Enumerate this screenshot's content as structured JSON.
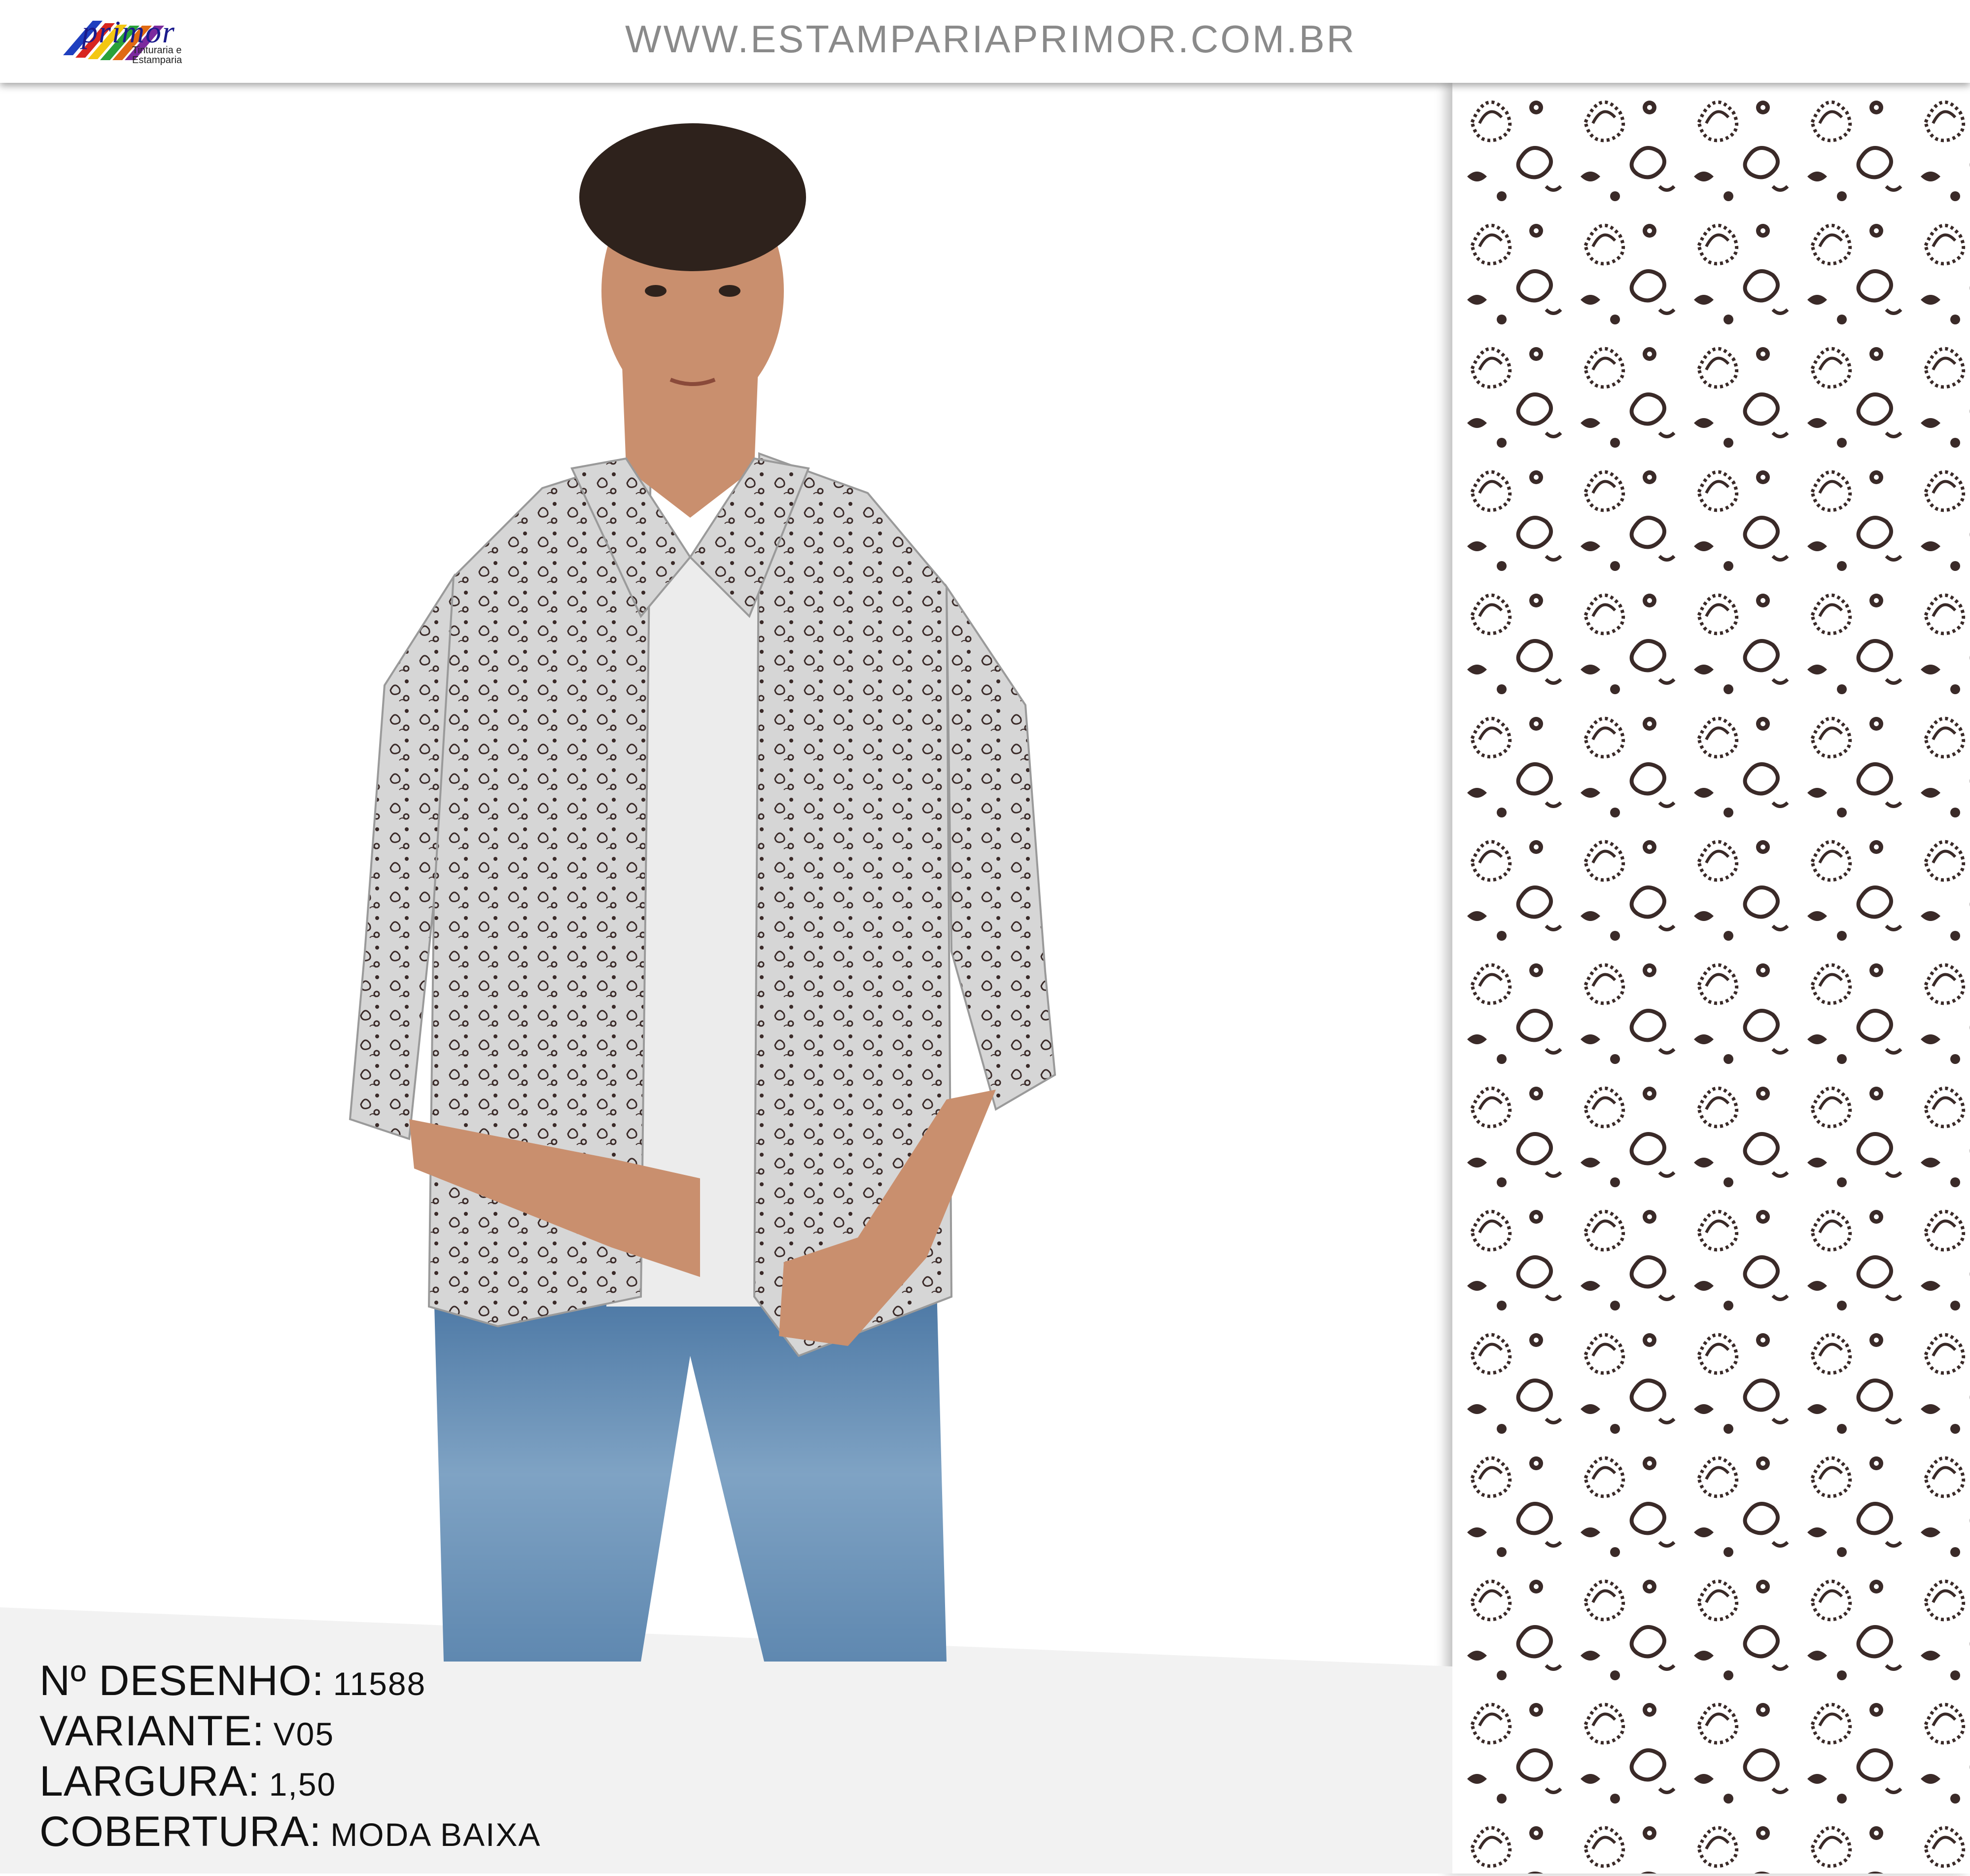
{
  "header": {
    "logo_text": "primor",
    "logo_tagline": "Tinturaria e Estamparia",
    "site_url": "WWW.ESTAMPARIAPRIMOR.COM.BR"
  },
  "product": {
    "image_alt": "Model wearing long-sleeve button shirt with paisley print, white t-shirt and blue jeans",
    "pattern_alt": "Paisley and flower print swatch",
    "print_color": "#3a2a28",
    "shirt_color": "#d6d6d6"
  },
  "specs": [
    {
      "label": "Nº DESENHO:",
      "value": "11588"
    },
    {
      "label": "VARIANTE:",
      "value": "V05"
    },
    {
      "label": "LARGURA:",
      "value": "1,50"
    },
    {
      "label": "COBERTURA:",
      "value": "MODA BAIXA"
    }
  ]
}
